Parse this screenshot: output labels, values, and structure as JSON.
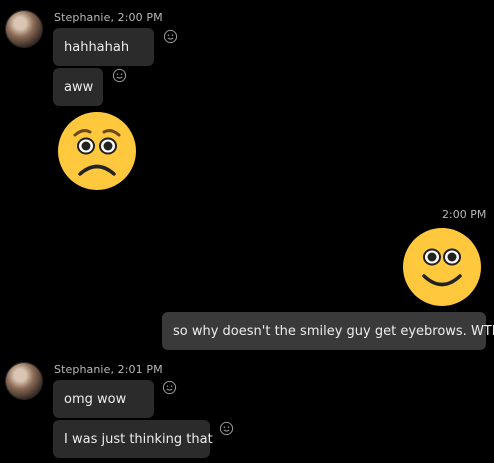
{
  "messages": [
    {
      "sender": "Stephanie, 2:00 PM",
      "text": "hahhahah"
    },
    {
      "text": "aww"
    },
    {
      "emoji": "worried-face"
    },
    {
      "time": "2:00 PM",
      "emoji": "smiling-face"
    },
    {
      "text": "so why doesn't the smiley guy get eyebrows.  WTF"
    },
    {
      "sender": "Stephanie, 2:01 PM",
      "text": "omg wow"
    },
    {
      "text": "I was just thinking that"
    }
  ],
  "colors": {
    "background": "#000000",
    "bubble_incoming": "#2b2b2b",
    "bubble_outgoing": "#3a3a3a",
    "emoji_yellow": "#ffc83d"
  },
  "icons": [
    "add-reaction-icon",
    "avatar"
  ]
}
